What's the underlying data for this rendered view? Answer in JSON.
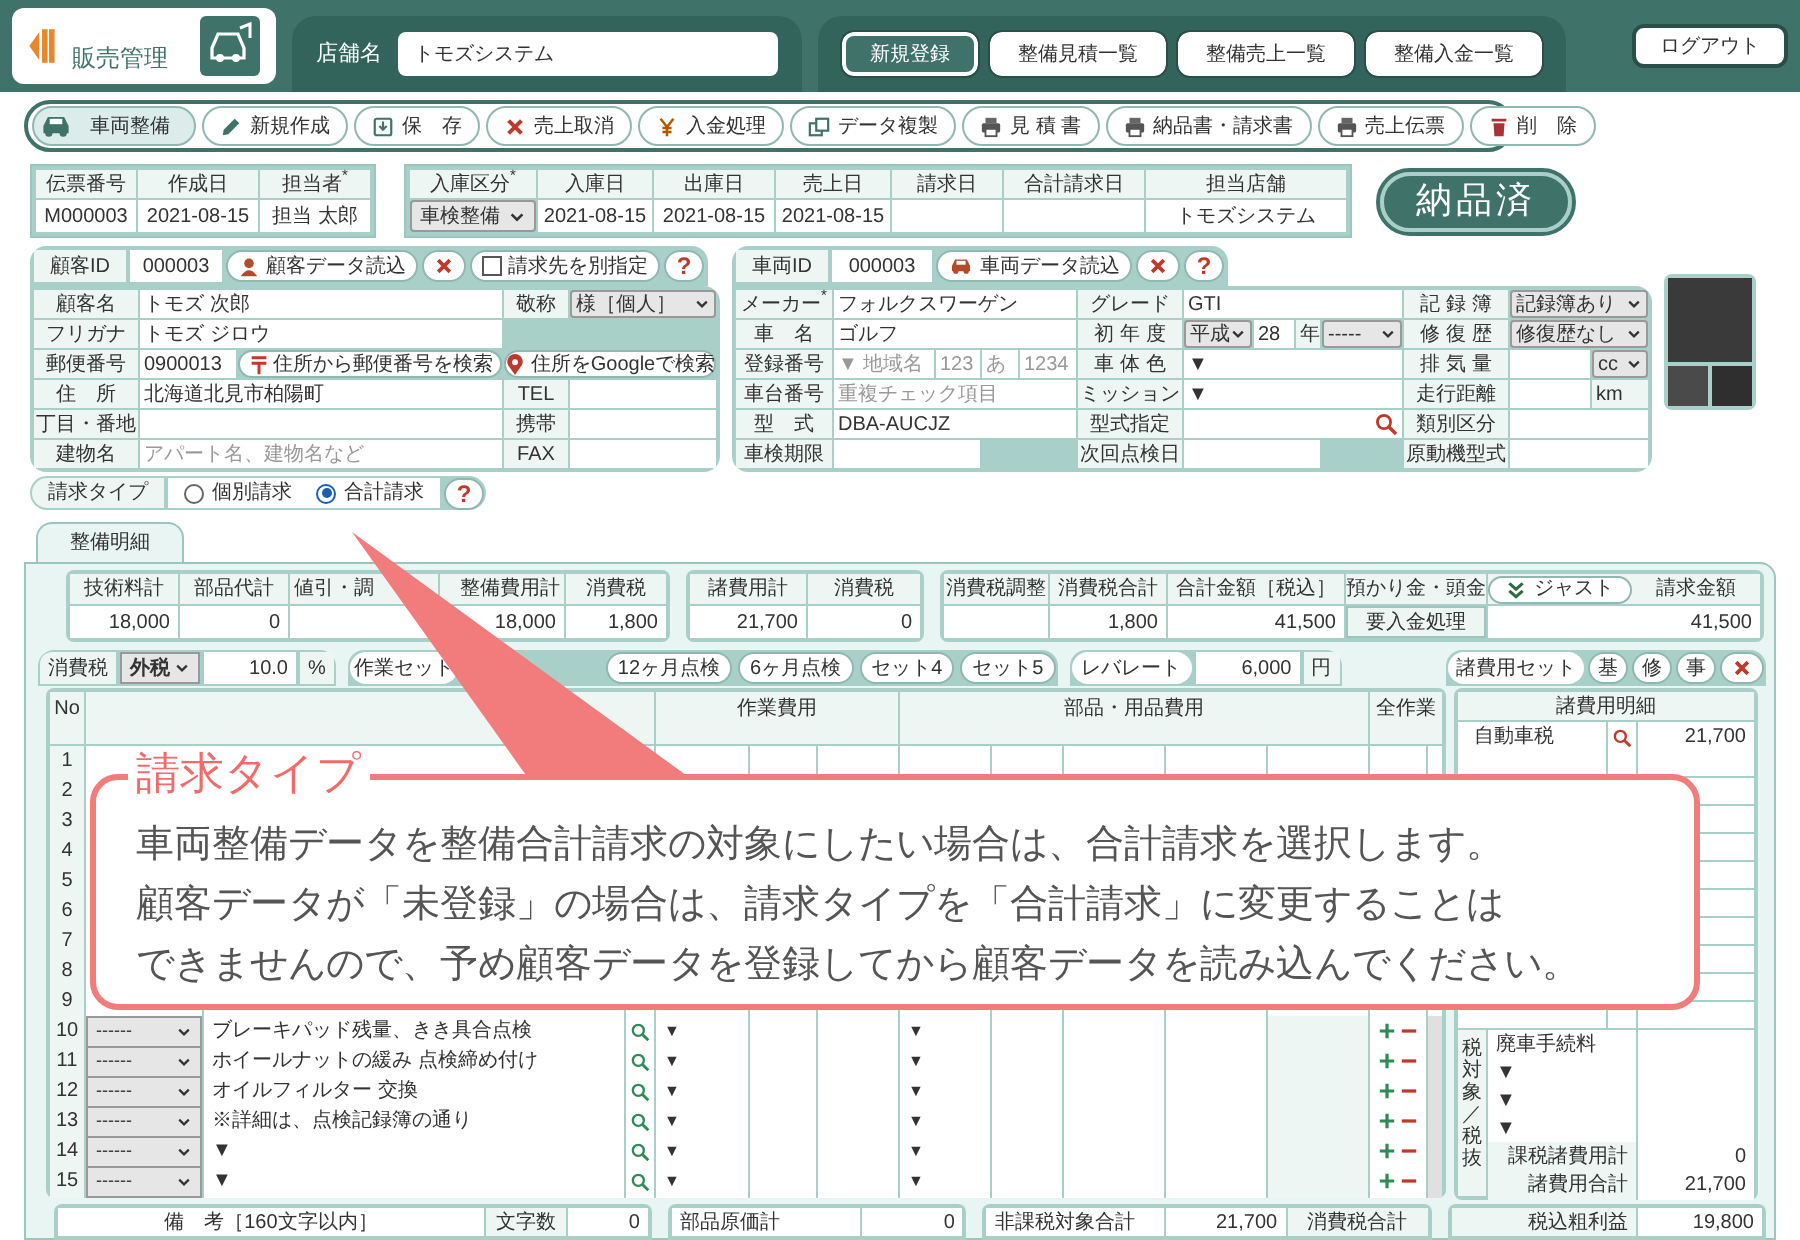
{
  "header": {
    "app_title": "販売管理",
    "store_label": "店舗名",
    "store_name": "トモズシステム",
    "nav_buttons": [
      {
        "label": "新規登録",
        "kind": "primary"
      },
      {
        "label": "整備見積一覧",
        "kind": "normal"
      },
      {
        "label": "整備売上一覧",
        "kind": "normal"
      },
      {
        "label": "整備入金一覧",
        "kind": "normal"
      }
    ],
    "logout": "ログアウト"
  },
  "toolbar": [
    {
      "label": "車両整備",
      "kind": "mode"
    },
    {
      "label": "新規作成",
      "kind": "new"
    },
    {
      "label": "保　存",
      "kind": "save"
    },
    {
      "label": "売上取消",
      "kind": "cancel"
    },
    {
      "label": "入金処理",
      "kind": "payment"
    },
    {
      "label": "データ複製",
      "kind": "copy"
    },
    {
      "label": "見 積 書",
      "kind": "print"
    },
    {
      "label": "納品書・請求書",
      "kind": "print"
    },
    {
      "label": "売上伝票",
      "kind": "print"
    },
    {
      "label": "削　除",
      "kind": "delete"
    }
  ],
  "slip": [
    {
      "header": "伝票番号",
      "value": "M000003"
    },
    {
      "header": "作成日",
      "value": "2021-08-15"
    },
    {
      "header": "担当者$^{*}$",
      "value": "担当 太郎"
    }
  ],
  "dates": [
    {
      "header": "入庫区分$^{*}$",
      "kind": "select",
      "value": "車検整備"
    },
    {
      "header": "入庫日",
      "kind": "text",
      "value": "2021-08-15"
    },
    {
      "header": "出庫日",
      "kind": "text",
      "value": "2021-08-15"
    },
    {
      "header": "売上日",
      "kind": "text",
      "value": "2021-08-15"
    },
    {
      "header": "請求日",
      "kind": "empty"
    },
    {
      "header": "合計請求日",
      "kind": "empty"
    },
    {
      "header": "担当店舗",
      "kind": "text",
      "value": "トモズシステム"
    }
  ],
  "status_badge": "納品済",
  "customer": {
    "id_label": "顧客ID",
    "id_value": "000003",
    "load_button": "顧客データ読込",
    "separate_billing": {
      "label": "請求先を別指定",
      "checked": false
    },
    "help": "?",
    "rows": [
      {
        "left": [
          {
            "kind": "label",
            "text": "顧客名"
          },
          {
            "kind": "value",
            "text": "トモズ 次郎"
          }
        ],
        "right": [
          {
            "kind": "label",
            "text": "敬称"
          },
          {
            "kind": "select",
            "text": "様［個人］"
          }
        ]
      },
      {
        "left": [
          {
            "kind": "label",
            "text": "フリガナ"
          },
          {
            "kind": "value",
            "text": "トモズ ジロウ"
          }
        ]
      },
      {
        "left": [
          {
            "kind": "label",
            "text": "郵便番号"
          },
          {
            "kind": "value",
            "text": "0900013"
          },
          {
            "kind": "button",
            "text": "住所から郵便番号を検索"
          }
        ],
        "right": [
          {
            "kind": "button",
            "text": "住所をGoogleで検索"
          }
        ]
      },
      {
        "left": [
          {
            "kind": "label",
            "text": "住　所"
          },
          {
            "kind": "value",
            "text": "北海道北見市柏陽町"
          }
        ],
        "right": [
          {
            "kind": "label",
            "text": "TEL"
          },
          {
            "kind": "input"
          }
        ]
      },
      {
        "left": [
          {
            "kind": "label",
            "text": "丁目・番地"
          },
          {
            "kind": "input"
          }
        ],
        "right": [
          {
            "kind": "label",
            "text": "携帯"
          },
          {
            "kind": "input"
          }
        ]
      },
      {
        "left": [
          {
            "kind": "label",
            "text": "建物名"
          },
          {
            "kind": "input",
            "placeholder": "アパート名、建物名など"
          }
        ],
        "right": [
          {
            "kind": "label",
            "text": "FAX"
          },
          {
            "kind": "input"
          }
        ]
      }
    ]
  },
  "vehicle": {
    "id_label": "車両ID",
    "id_value": "000003",
    "load_button": "車両データ読込",
    "help": "?",
    "rows": [
      {
        "left": [
          {
            "kind": "label",
            "text": "メーカー$^{*}$"
          },
          {
            "kind": "value",
            "text": "フォルクスワーゲン"
          }
        ],
        "middle": [
          {
            "kind": "label",
            "text": "グレード"
          },
          {
            "kind": "value",
            "text": "GTI"
          }
        ],
        "right": [
          {
            "kind": "label",
            "text": "記 録 簿"
          },
          {
            "kind": "select",
            "text": "記録簿あり"
          }
        ]
      },
      {
        "left": [
          {
            "kind": "label",
            "text": "車　名"
          },
          {
            "kind": "value",
            "text": "ゴルフ"
          }
        ],
        "middle": [
          {
            "kind": "label",
            "text": "初 年 度"
          },
          {
            "kind": "select",
            "text": "平成"
          },
          {
            "kind": "value",
            "text": "28"
          },
          {
            "kind": "unit",
            "text": "年"
          },
          {
            "kind": "select",
            "text": "-----"
          }
        ],
        "right": [
          {
            "kind": "label",
            "text": "修 復 歴"
          },
          {
            "kind": "select",
            "text": "修復歴なし"
          }
        ]
      },
      {
        "left": [
          {
            "kind": "label",
            "text": "登録番号"
          },
          {
            "kind": "input",
            "placeholder": "▼ 地域名"
          },
          {
            "kind": "input",
            "placeholder": "123"
          },
          {
            "kind": "input",
            "placeholder": "あ"
          },
          {
            "kind": "input",
            "placeholder": "1234"
          }
        ],
        "middle": [
          {
            "kind": "label",
            "text": "車 体 色"
          },
          {
            "kind": "value",
            "text": "▼"
          }
        ],
        "right": [
          {
            "kind": "label",
            "text": "排 気 量"
          },
          {
            "kind": "input"
          },
          {
            "kind": "select",
            "text": "cc"
          }
        ]
      },
      {
        "left": [
          {
            "kind": "label",
            "text": "車台番号"
          },
          {
            "kind": "input",
            "placeholder": "重複チェック項目"
          }
        ],
        "middle": [
          {
            "kind": "label",
            "text": "ミッション"
          },
          {
            "kind": "value",
            "text": "▼"
          }
        ],
        "right": [
          {
            "kind": "label",
            "text": "走行距離"
          },
          {
            "kind": "input"
          },
          {
            "kind": "unit",
            "text": "km"
          }
        ]
      },
      {
        "left": [
          {
            "kind": "label",
            "text": "型　式"
          },
          {
            "kind": "value",
            "text": "DBA-AUCJZ"
          }
        ],
        "middle": [
          {
            "kind": "label",
            "text": "型式指定"
          },
          {
            "kind": "search"
          }
        ],
        "right": [
          {
            "kind": "label",
            "text": "類別区分"
          },
          {
            "kind": "input"
          }
        ]
      },
      {
        "left": [
          {
            "kind": "label",
            "text": "車検期限"
          },
          {
            "kind": "input"
          }
        ],
        "middle": [
          {
            "kind": "label",
            "text": "次回点検日"
          },
          {
            "kind": "input"
          }
        ],
        "right": [
          {
            "kind": "label",
            "text": "原動機型式"
          },
          {
            "kind": "input"
          }
        ]
      }
    ]
  },
  "billing_type": {
    "label": "請求タイプ",
    "options": [
      {
        "label": "個別請求",
        "selected": false
      },
      {
        "label": "合計請求",
        "selected": true
      }
    ],
    "help": "?"
  },
  "tabs": [
    {
      "label": "整備明細",
      "selected": true
    }
  ],
  "summary": [
    [
      {
        "header": "技術料計",
        "kind": "value",
        "value": "18,000"
      },
      {
        "header": "部品代計",
        "kind": "value",
        "value": "0"
      },
      {
        "header": "値引・調",
        "kind": "input"
      },
      {
        "header": "整備費用計",
        "kind": "value",
        "value": "18,000"
      },
      {
        "header": "消費税",
        "kind": "value",
        "value": "1,800"
      }
    ],
    [
      {
        "header": "諸費用計",
        "kind": "value",
        "value": "21,700"
      },
      {
        "header": "消費税",
        "kind": "value",
        "value": "0"
      }
    ],
    [
      {
        "header": "消費税調整",
        "kind": "input"
      },
      {
        "header": "消費税合計",
        "kind": "value",
        "value": "1,800"
      },
      {
        "header": "合計金額［税込］",
        "kind": "value",
        "value": "41,500"
      },
      {
        "header": "預かり金・頭金",
        "kind": "button",
        "value": "要入金処理"
      },
      {
        "header": "請求金額",
        "kind": "value",
        "value": "41,500",
        "header_button": "ジャスト"
      }
    ]
  ],
  "tax": {
    "label": "消費税",
    "mode": "外税",
    "rate": "10.0",
    "unit": "%"
  },
  "work_sets": {
    "label": "作業セット",
    "buttons": [
      "12ヶ月点検",
      "6ヶ月点検",
      "セット4",
      "セット5"
    ]
  },
  "labor_rate": {
    "label": "レバレート",
    "value": "6,000",
    "unit": "円"
  },
  "fee_sets": {
    "label": "諸費用セット",
    "buttons": [
      "基",
      "修",
      "事"
    ]
  },
  "detail_table": {
    "columns": [
      "No",
      "作業費用",
      "部品・用品費用",
      "全作業"
    ],
    "rows": [
      {
        "no": "1"
      },
      {
        "no": "2"
      },
      {
        "no": "3"
      },
      {
        "no": "4"
      },
      {
        "no": "5"
      },
      {
        "no": "6"
      },
      {
        "no": "7"
      },
      {
        "no": "8"
      },
      {
        "no": "9"
      },
      {
        "no": "10",
        "type": "------",
        "work": "ブレーキパッド残量、きき具合点検",
        "staff": "▼",
        "part": "▼"
      },
      {
        "no": "11",
        "type": "------",
        "work": "ホイールナットの緩み 点検締め付け",
        "staff": "▼",
        "part": "▼"
      },
      {
        "no": "12",
        "type": "------",
        "work": "オイルフィルター 交換",
        "staff": "▼",
        "part": "▼"
      },
      {
        "no": "13",
        "type": "------",
        "work": "※詳細は、点検記録簿の通り",
        "staff": "▼",
        "part": "▼"
      },
      {
        "no": "14",
        "type": "------",
        "work": "▼",
        "staff": "▼",
        "part": "▼"
      },
      {
        "no": "15",
        "type": "------",
        "work": "▼",
        "staff": "▼",
        "part": "▼"
      }
    ]
  },
  "fees": {
    "header": "諸費用明細",
    "rows": [
      {
        "name": "自動車税",
        "amount": "21,700"
      }
    ],
    "taxable_label": "税対象／税抜",
    "taxable_rows": [
      {
        "name": "廃車手続料"
      },
      {
        "name": "▼"
      },
      {
        "name": "▼"
      },
      {
        "name": "▼"
      }
    ],
    "totals": [
      {
        "label": "課税諸費用計",
        "value": "0"
      },
      {
        "label": "諸費用合計",
        "value": "21,700"
      }
    ]
  },
  "footer": {
    "remarks": {
      "header": "備　考［160文字以内］",
      "count_label": "文字数",
      "count": "0"
    },
    "parts_cost": {
      "label": "部品原価計",
      "value": "0"
    },
    "non_taxable": {
      "label": "非課税対象合計",
      "value": "21,700",
      "next_label": "消費税合計"
    },
    "gross_profit": {
      "label": "税込粗利益",
      "value": "19,800"
    }
  },
  "callout": {
    "title": "請求タイプ",
    "lines": [
      "車両整備データを整備合計請求の対象にしたい場合は、合計請求を選択します。",
      "顧客データが「未登録」の場合は、請求タイプを「合計請求」に変更することは",
      "できませんので、予め顧客データを登録してから顧客データを読み込んでください。"
    ]
  }
}
